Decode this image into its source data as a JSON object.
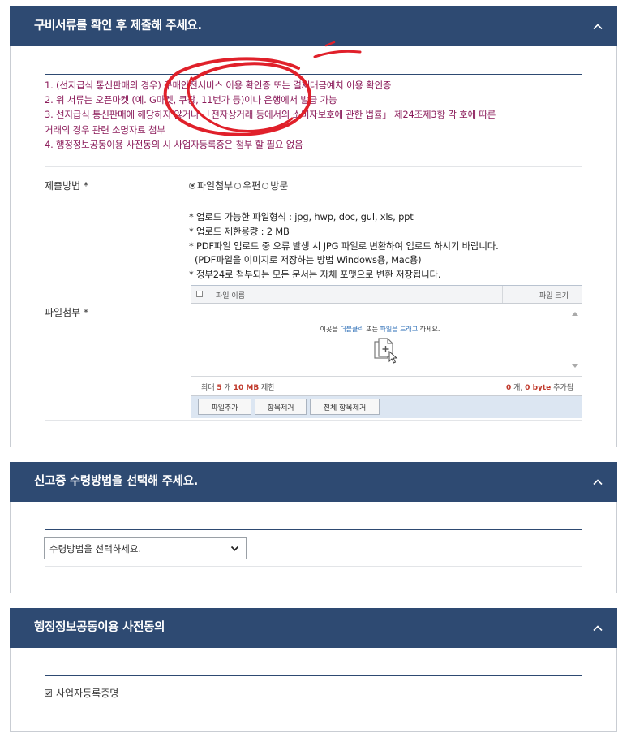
{
  "section1": {
    "title": "구비서류를 확인 후 제출해 주세요.",
    "notices": [
      "1. (선지급식 통신판매의 경우) 구매안전서비스 이용 확인증 또는 결제대금예치 이용 확인증",
      "2. 위 서류는 오픈마켓 (예. G마켓, 쿠팡, 11번가 등)이나 은행에서 발급 가능",
      "3. 선지급식 통신판매에 해당하지 않거나 「전자상거래 등에서의 소비자보호에 관한 법률」 제24조제3항 각 호에 따른",
      "거래의 경우 관련 소명자료 첨부",
      "4. 행정정보공동이용 사전동의 시 사업자등록증은 첨부 할 필요 없음"
    ],
    "submit_method_label": "제출방법 *",
    "radio_options": [
      "파일첨부",
      "우편",
      "방문"
    ],
    "selected_option": "파일첨부",
    "file_attach_label": "파일첨부 *",
    "upload_info": [
      "* 업로드 가능한 파일형식 : jpg, hwp, doc, gul, xls, ppt",
      "* 업로드 제한용량 : 2 MB",
      "* PDF파일 업로드 중 오류 발생 시 JPG 파일로 변환하여 업로드 하시기 바랍니다.",
      "  (PDF파일을 이미지로 저장하는 방법  Windows용, Mac용)",
      "* 정부24로 첨부되는 모든 문서는 자체 포맷으로 변환 저장됩니다."
    ],
    "uploader": {
      "col_name": "파일 이름",
      "col_size": "파일 크기",
      "drop_pre": "이곳을 ",
      "drop_dbl": "더블클릭",
      "drop_mid": " 또는 ",
      "drop_drag": "파일을 드래그",
      "drop_post": " 하세요.",
      "limit_pre": "최대 ",
      "limit_count": "5",
      "limit_mid": " 개 ",
      "limit_size": "10 MB",
      "limit_post": " 제한",
      "added_count": "0",
      "added_mid": " 개, ",
      "added_size": "0 byte",
      "added_post": " 추가됨",
      "btn_add": "파일추가",
      "btn_remove": "항목제거",
      "btn_remove_all": "전체 항목제거"
    }
  },
  "section2": {
    "title": "신고증 수령방법을 선택해 주세요.",
    "select_value": "수령방법을 선택하세요."
  },
  "section3": {
    "title": "행정정보공동이용 사전동의",
    "checkbox_label": "사업자등록증명",
    "checked": true
  },
  "colors": {
    "header_bg": "#2e4a72",
    "notice_text": "#8b1b5a",
    "scribble": "#e0202a"
  }
}
